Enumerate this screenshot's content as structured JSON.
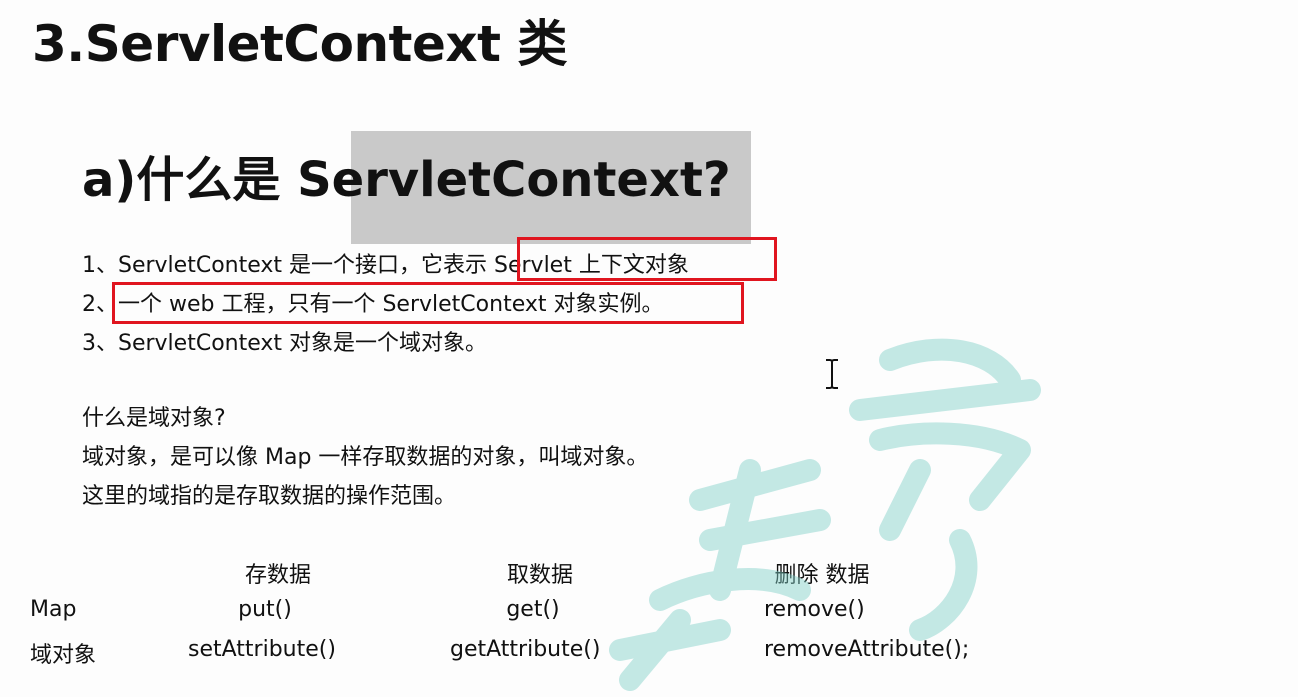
{
  "title": "3.ServletContext 类",
  "subtitle": {
    "prefix": "a)什么是",
    "name": "ServletContext",
    "question_mark": "?"
  },
  "points": [
    "1、ServletContext 是一个接口，它表示 Servlet 上下文对象",
    "2、一个 web 工程，只有一个 ServletContext 对象实例。",
    "3、ServletContext 对象是一个域对象。"
  ],
  "domain": {
    "question": "什么是域对象?",
    "line1": "域对象，是可以像 Map 一样存取数据的对象，叫域对象。",
    "line2": "这里的域指的是存取数据的操作范围。"
  },
  "table": {
    "headers": [
      "存数据",
      "取数据",
      "删除 数据"
    ],
    "rows": [
      {
        "label": "Map",
        "cells": [
          "put()",
          "get()",
          "remove()"
        ]
      },
      {
        "label": "域对象",
        "cells": [
          "setAttribute()",
          "getAttribute()",
          "removeAttribute();"
        ]
      }
    ]
  },
  "icons": {
    "cursor": "text-cursor-icon",
    "watermark": "watermark-logo-icon"
  },
  "colors": {
    "highlight_box": "#e0151f",
    "selection": "#c9c9c9",
    "watermark": "#7fcfc8"
  }
}
